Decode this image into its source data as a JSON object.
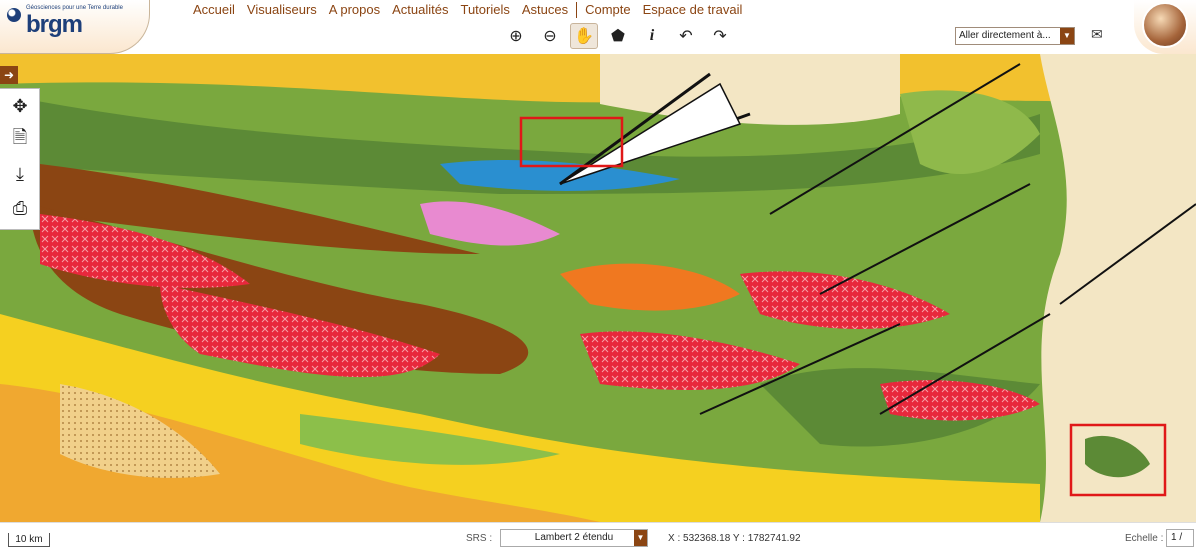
{
  "header": {
    "logo_tagline": "Géosciences pour une Terre durable",
    "logo_text": "brgm",
    "nav": [
      {
        "label": "Accueil"
      },
      {
        "label": "Visualiseurs"
      },
      {
        "label": "A propos"
      },
      {
        "label": "Actualités"
      },
      {
        "label": "Tutoriels"
      },
      {
        "label": "Astuces"
      },
      {
        "label": "Compte"
      },
      {
        "label": "Espace de travail"
      }
    ],
    "tools": [
      {
        "icon": "zoom-in-icon",
        "glyph": "⊕"
      },
      {
        "icon": "zoom-out-icon",
        "glyph": "⊖"
      },
      {
        "icon": "pan-hand-icon",
        "glyph": "✋"
      },
      {
        "icon": "france-map-icon",
        "glyph": "⬟"
      },
      {
        "icon": "info-icon",
        "glyph": "i"
      },
      {
        "icon": "undo-icon",
        "glyph": "↶"
      },
      {
        "icon": "redo-icon",
        "glyph": "↷"
      }
    ],
    "goto_select": "Aller directement à...",
    "mail_icon": "✉"
  },
  "side_panel": {
    "toggle_glyph": "➜",
    "tools": [
      {
        "icon": "move-arrows-icon",
        "glyph": "✥"
      },
      {
        "icon": "document-search-icon",
        "glyph": "🗎"
      },
      {
        "icon": "download-icon",
        "glyph": "⤓"
      },
      {
        "icon": "print-icon",
        "glyph": "⎙"
      }
    ]
  },
  "status": {
    "scale": "10 km",
    "srs_label": "SRS :",
    "srs_value": "Lambert 2 étendu",
    "coordinates": "X : 532368.18 Y : 1782741.92",
    "echelle_label": "Echelle :",
    "echelle_value": "1 /"
  },
  "map": {
    "colors": {
      "green": "#5c8a36",
      "light_green": "#8cbf4a",
      "brown": "#8b4513",
      "red": "#e8283c",
      "orange": "#f07820",
      "yellow": "#f5d020",
      "cream": "#f3e6c4",
      "pink": "#e88ad0",
      "blue": "#2a8fd0",
      "highlight_box": "#e01818"
    }
  }
}
